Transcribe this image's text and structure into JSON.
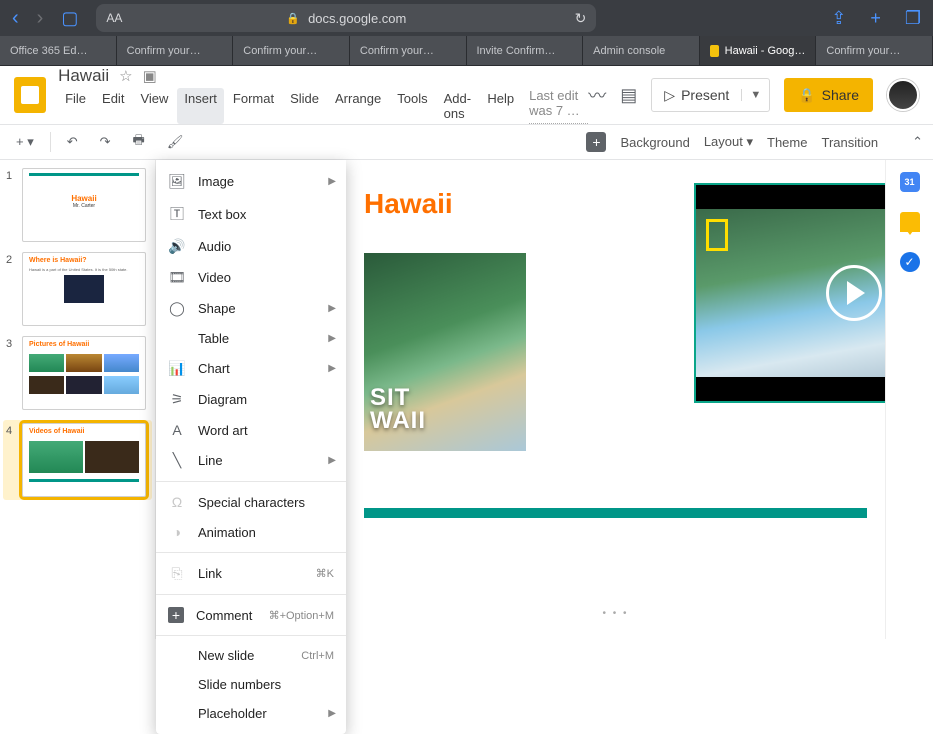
{
  "browser": {
    "url_host": "docs.google.com",
    "tabs": [
      {
        "label": "Office 365 Ed…"
      },
      {
        "label": "Confirm your…"
      },
      {
        "label": "Confirm your…"
      },
      {
        "label": "Confirm your…"
      },
      {
        "label": "Invite Confirm…"
      },
      {
        "label": "Admin console"
      },
      {
        "label": "Hawaii - Goog…",
        "active": true
      },
      {
        "label": "Confirm your…"
      }
    ]
  },
  "doc": {
    "title": "Hawaii",
    "last_edit": "Last edit was 7 …"
  },
  "menubar": {
    "items": [
      "File",
      "Edit",
      "View",
      "Insert",
      "Format",
      "Slide",
      "Arrange",
      "Tools",
      "Add-ons",
      "Help"
    ],
    "active": "Insert"
  },
  "actions": {
    "present": "Present",
    "share": "Share"
  },
  "toolbar_right": {
    "background": "Background",
    "layout": "Layout",
    "theme": "Theme",
    "transition": "Transition"
  },
  "insert_menu": {
    "image": "Image",
    "textbox": "Text box",
    "audio": "Audio",
    "video": "Video",
    "shape": "Shape",
    "table": "Table",
    "chart": "Chart",
    "diagram": "Diagram",
    "wordart": "Word art",
    "line": "Line",
    "special": "Special characters",
    "animation": "Animation",
    "link": "Link",
    "link_shortcut": "⌘K",
    "comment": "Comment",
    "comment_shortcut": "⌘+Option+M",
    "newslide": "New slide",
    "newslide_shortcut": "Ctrl+M",
    "slidenumbers": "Slide numbers",
    "placeholder": "Placeholder"
  },
  "thumbs": [
    {
      "n": "1",
      "title": "Hawaii",
      "sub": "Mr. Carter"
    },
    {
      "n": "2",
      "title": "Where is Hawaii?"
    },
    {
      "n": "3",
      "title": "Pictures of Hawaii"
    },
    {
      "n": "4",
      "title": "Videos of Hawaii",
      "active": true
    }
  ],
  "canvas": {
    "heading": "Hawaii",
    "left_overlay1": "SIT",
    "left_overlay2": "WAII"
  }
}
